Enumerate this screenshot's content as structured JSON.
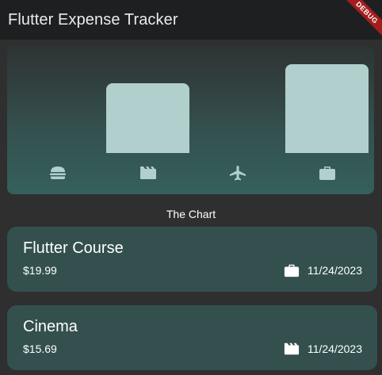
{
  "appbar": {
    "title": "Flutter Expense Tracker",
    "debug_label": "DEBUG"
  },
  "chart": {
    "categories": [
      {
        "icon": "food-icon",
        "fill": 0.0
      },
      {
        "icon": "leisure-icon",
        "fill": 0.79
      },
      {
        "icon": "travel-icon",
        "fill": 0.0
      },
      {
        "icon": "work-icon",
        "fill": 1.0
      }
    ],
    "caption": "The Chart",
    "bar_color": "#b1cfcd"
  },
  "expenses": [
    {
      "title": "Flutter Course",
      "amount": "$19.99",
      "date": "11/24/2023",
      "icon": "work-icon"
    },
    {
      "title": "Cinema",
      "amount": "$15.69",
      "date": "11/24/2023",
      "icon": "leisure-icon"
    }
  ]
}
